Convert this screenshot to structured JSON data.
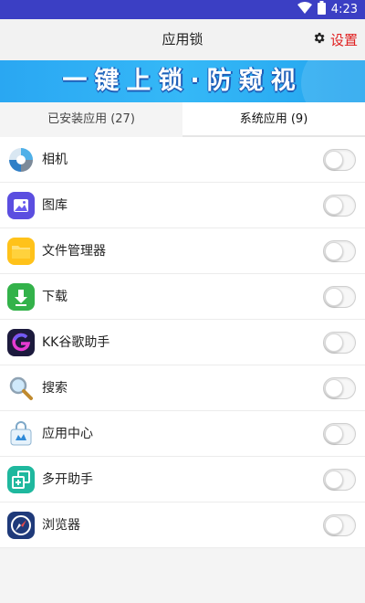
{
  "status_bar": {
    "time": "4:23",
    "wifi_icon": "wifi-icon",
    "battery_icon": "battery-icon"
  },
  "app_bar": {
    "title": "应用锁",
    "settings_label": "设置",
    "settings_icon": "gear-icon"
  },
  "banner": {
    "text": "一键上锁·防窥视"
  },
  "tabs": [
    {
      "label": "已安装应用 (27)",
      "active": false
    },
    {
      "label": "系统应用 (9)",
      "active": true
    }
  ],
  "apps": [
    {
      "name": "相机",
      "icon": "camera-icon",
      "locked": false
    },
    {
      "name": "图库",
      "icon": "gallery-icon",
      "locked": false
    },
    {
      "name": "文件管理器",
      "icon": "folder-icon",
      "locked": false
    },
    {
      "name": "下载",
      "icon": "download-icon",
      "locked": false
    },
    {
      "name": "KK谷歌助手",
      "icon": "google-helper-icon",
      "locked": false
    },
    {
      "name": "搜索",
      "icon": "search-icon",
      "locked": false
    },
    {
      "name": "应用中心",
      "icon": "app-center-icon",
      "locked": false
    },
    {
      "name": "多开助手",
      "icon": "multi-open-icon",
      "locked": false
    },
    {
      "name": "浏览器",
      "icon": "browser-icon",
      "locked": false
    }
  ],
  "colors": {
    "status_bar": "#3b3fc4",
    "accent_red": "#e02020",
    "banner": "#2aa7f2"
  }
}
